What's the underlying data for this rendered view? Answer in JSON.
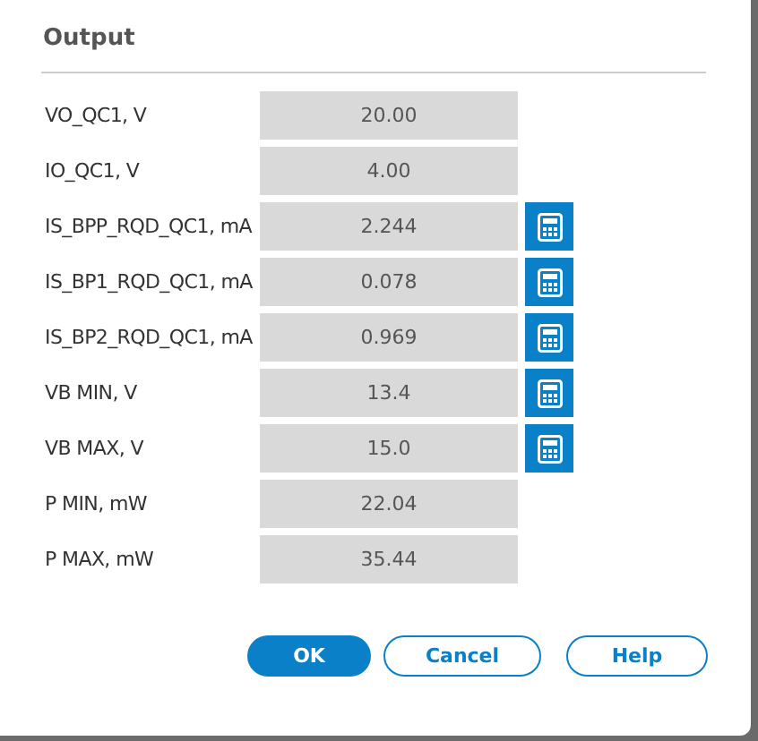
{
  "dialog": {
    "title": "Output"
  },
  "rows": [
    {
      "label": "VO_QC1, V",
      "value": "20.00",
      "calculator": false
    },
    {
      "label": "IO_QC1, V",
      "value": "4.00",
      "calculator": false
    },
    {
      "label": "IS_BPP_RQD_QC1, mA",
      "value": "2.244",
      "calculator": true
    },
    {
      "label": "IS_BP1_RQD_QC1, mA",
      "value": "0.078",
      "calculator": true
    },
    {
      "label": "IS_BP2_RQD_QC1, mA",
      "value": "0.969",
      "calculator": true
    },
    {
      "label": "VB MIN, V",
      "value": "13.4",
      "calculator": true
    },
    {
      "label": "VB MAX, V",
      "value": "15.0",
      "calculator": true
    },
    {
      "label": "P MIN, mW",
      "value": "22.04",
      "calculator": false
    },
    {
      "label": "P MAX, mW",
      "value": "35.44",
      "calculator": false
    }
  ],
  "buttons": [
    {
      "label": "OK",
      "kind": "primary"
    },
    {
      "label": "Cancel",
      "kind": "secondary"
    },
    {
      "label": "Help",
      "kind": "secondary"
    }
  ]
}
